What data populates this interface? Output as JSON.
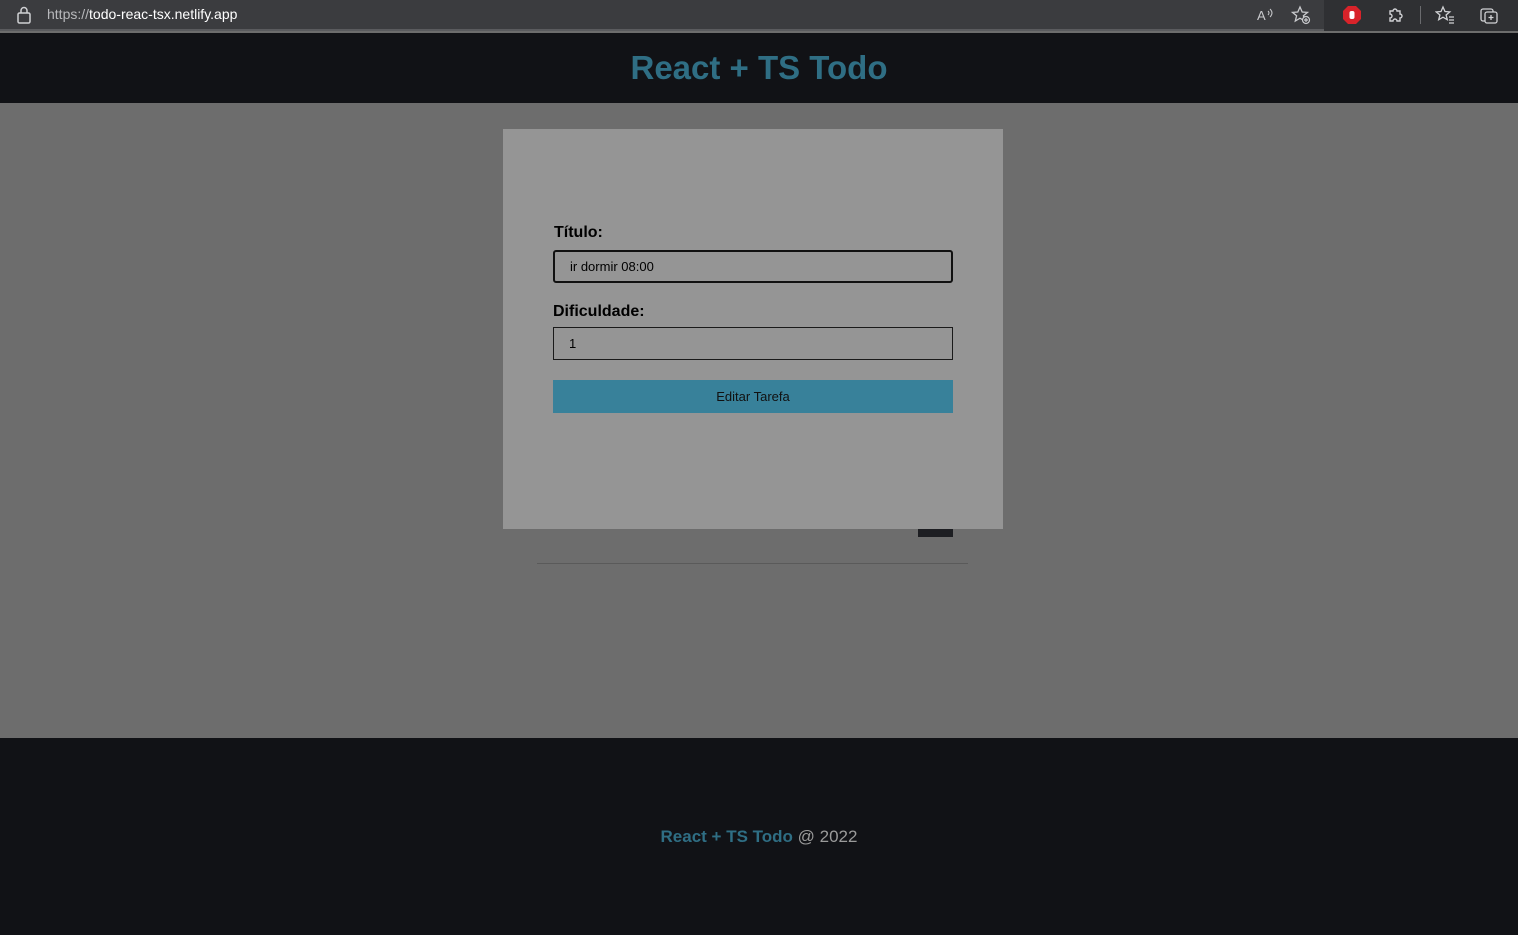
{
  "browser": {
    "url_scheme": "https://",
    "url_host": "todo-reac-tsx.netlify.app",
    "icons": [
      "lock-icon",
      "read-aloud-icon",
      "add-favorite-icon",
      "adblock-icon",
      "extensions-icon",
      "favorites-icon",
      "collections-icon"
    ]
  },
  "header": {
    "title": "React + TS Todo"
  },
  "modal": {
    "title_label": "Título:",
    "title_value": "ir dormir 08:00",
    "difficulty_label": "Dificuldade:",
    "difficulty_value": "1",
    "submit_label": "Editar Tarefa"
  },
  "footer": {
    "brand": "React + TS Todo",
    "suffix": "@ 2022"
  },
  "colors": {
    "accent": "#2f6e84",
    "button": "#38819a",
    "dark": "#111216",
    "overlay": "#6d6d6d",
    "modal_bg": "#959595"
  }
}
